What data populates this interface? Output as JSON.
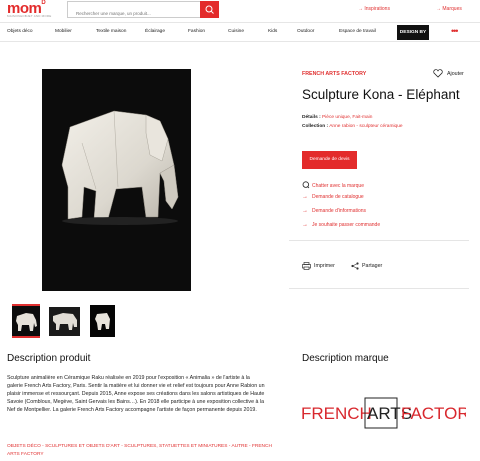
{
  "header": {
    "logo": "mom",
    "logo_sup": "D",
    "logo_sub": "MAISON&OBJET AND MORE",
    "search_placeholder": "Rechercher une marque, un produit...",
    "inspirations": "Inspirations",
    "marques": "Marques"
  },
  "nav": {
    "items": [
      "Objets déco",
      "Mobilier",
      "Textile maison",
      "Éclairage",
      "Fashion",
      "Cuisine",
      "Kids",
      "Outdoor",
      "Espace de travail"
    ],
    "design_by": "DESIGN BY",
    "more": "•••"
  },
  "product": {
    "brand": "FRENCH ARTS FACTORY",
    "favorite": "Ajouter",
    "title": "Sculpture Kona - Eléphant",
    "details_label": "Détails :",
    "details_value": "Pièce unique, Fait-main",
    "collection_label": "Collection :",
    "collection_value": "Anne rabion - sculpteur céramique",
    "quote_button": "Demande de devis",
    "actions": [
      "Chatter avec la marque",
      "Demande de catalogue",
      "Demande d'informations",
      "Je souhaite passer commande"
    ],
    "print": "Imprimer",
    "share": "Partager"
  },
  "description": {
    "title": "Description produit",
    "text": "Sculpture animalière en Céramique Raku réalisée en 2019 pour l'exposition « Animalia » de l'artiste à la galerie French Arts Factory, Paris. Sentir la matière et lui donner vie et relief est toujours pour Anne Rabion un plaisir immense et ressourçant. Depuis 2015, Anne expose ses créations dans les salons artistiques de Haute Savoie (Combloux, Megève, Saint Gervais les Bains…). En 2018 elle participe à une exposition collective à la Nef de Montpellier. La galerie French Arts Factory accompagne l'artiste de façon permanente depuis 2019.",
    "categories": "OBJETS DÉCO - SCULPTURES ET OBJETS D'ART - SCULPTURES, STATUETTES ET MINIATURES - AUTRE - FRENCH ARTS FACTORY"
  },
  "brand_section": {
    "title": "Description marque",
    "logo_word1": "FRENCH",
    "logo_word2": "ARTS",
    "logo_word3": "FACTORY"
  },
  "colors": {
    "accent": "#e32b2b",
    "dark": "#111111"
  }
}
